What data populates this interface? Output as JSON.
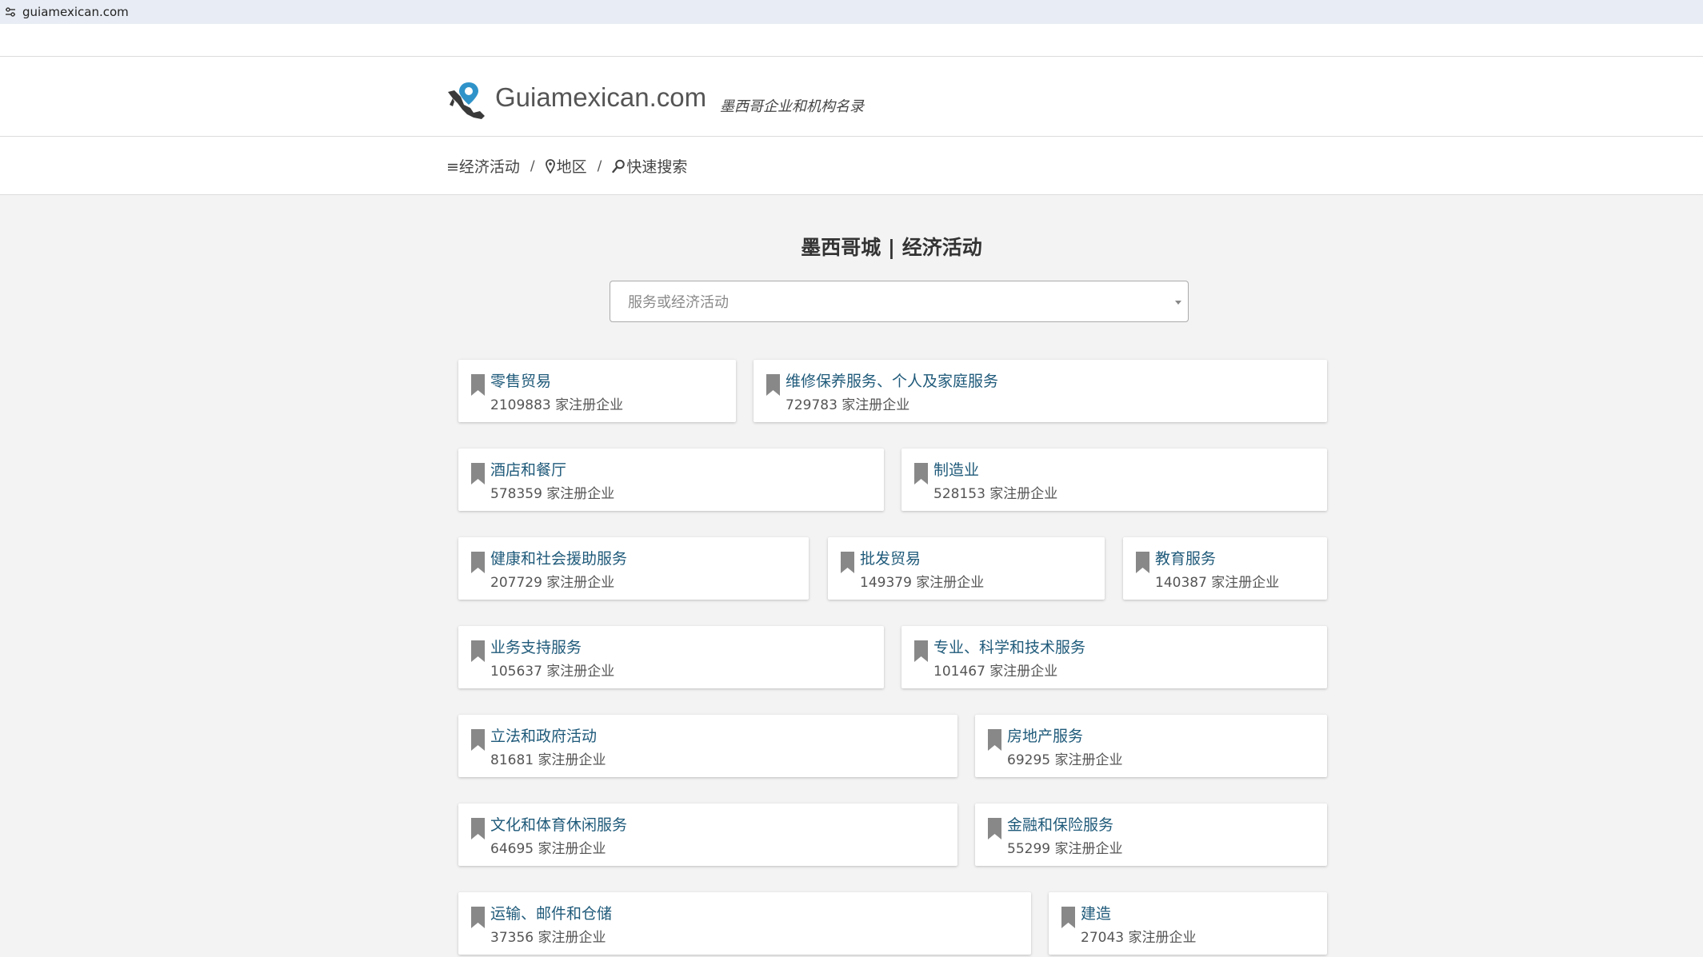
{
  "browser": {
    "url": "guiamexican.com"
  },
  "header": {
    "site_name": "Guiamexican.com",
    "tagline": "墨西哥企业和机构名录"
  },
  "nav": {
    "items": [
      "≡经济活动",
      "地区",
      "快速搜索"
    ],
    "separator": "/"
  },
  "page": {
    "title": "墨西哥城 | 经济活动"
  },
  "search": {
    "placeholder": "服务或经济活动"
  },
  "colors": {
    "link": "#1f5a7a",
    "bookmark": "#888888",
    "background": "#f3f3f3"
  },
  "categories": [
    {
      "title": "零售贸易",
      "count": "2109883 家注册企业"
    },
    {
      "title": "维修保养服务、个人及家庭服务",
      "count": "729783 家注册企业"
    },
    {
      "title": "酒店和餐厅",
      "count": "578359 家注册企业"
    },
    {
      "title": "制造业",
      "count": "528153 家注册企业"
    },
    {
      "title": "健康和社会援助服务",
      "count": "207729 家注册企业"
    },
    {
      "title": "批发贸易",
      "count": "149379 家注册企业"
    },
    {
      "title": "教育服务",
      "count": "140387 家注册企业"
    },
    {
      "title": "业务支持服务",
      "count": "105637 家注册企业"
    },
    {
      "title": "专业、科学和技术服务",
      "count": "101467 家注册企业"
    },
    {
      "title": "立法和政府活动",
      "count": "81681 家注册企业"
    },
    {
      "title": "房地产服务",
      "count": "69295 家注册企业"
    },
    {
      "title": "文化和体育休闲服务",
      "count": "64695 家注册企业"
    },
    {
      "title": "金融和保险服务",
      "count": "55299 家注册企业"
    },
    {
      "title": "运输、邮件和仓储",
      "count": "37356 家注册企业"
    },
    {
      "title": "建造",
      "count": "27043 家注册企业"
    }
  ]
}
